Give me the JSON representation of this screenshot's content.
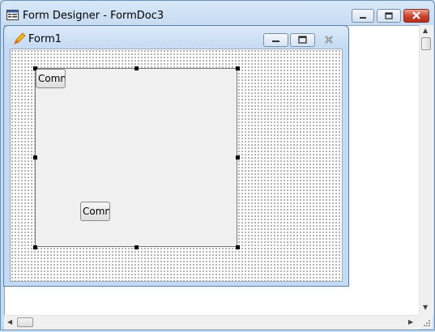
{
  "outer_window": {
    "title": "Form Designer - FormDoc3",
    "icon": "form-designer-icon",
    "buttons": [
      "minimize",
      "maximize",
      "close"
    ]
  },
  "form_window": {
    "title": "Form1",
    "icon": "form-pencil-icon",
    "buttons": [
      "minimize",
      "maximize",
      "close"
    ]
  },
  "controls": {
    "command_button_1": "Comn",
    "command_button_2": "Comn"
  },
  "scrollbars": {
    "vertical_up": "▲",
    "vertical_down": "▼",
    "horizontal_left": "◀",
    "horizontal_right": "▶"
  }
}
